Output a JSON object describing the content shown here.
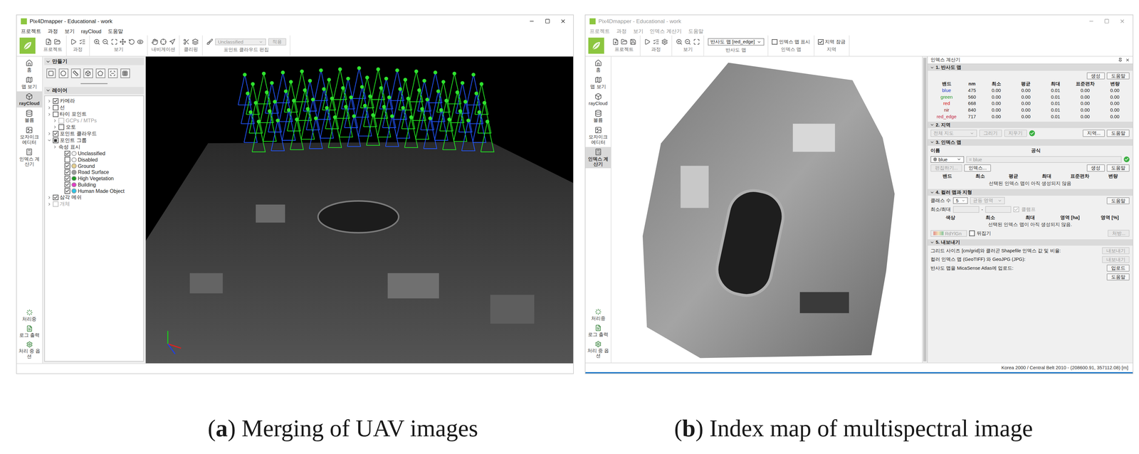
{
  "left_window": {
    "title": "Pix4Dmapper - Educational - work",
    "active": true,
    "menu": [
      "프로젝트",
      "과정",
      "보기",
      "rayCloud",
      "도움말"
    ],
    "toolbar_groups": [
      "프로젝트",
      "과정",
      "보기",
      "내비게이션",
      "클리핑",
      "포인트 클라우드 편집"
    ],
    "class_select": {
      "value": "Unclassified",
      "disabled": true
    },
    "apply_button": {
      "label": "적용",
      "disabled": true
    },
    "nav": [
      {
        "label": "홈",
        "selected": false
      },
      {
        "label": "맵 보기",
        "selected": false
      },
      {
        "label": "rayCloud",
        "selected": true
      },
      {
        "label": "볼륨",
        "selected": false
      },
      {
        "label": "모자이크 에디터",
        "selected": false
      },
      {
        "label": "인덱스 계산기",
        "selected": false
      }
    ],
    "nav_bottom": [
      "처리중",
      "로그 출력",
      "처리 중 옵션"
    ],
    "create_panel": {
      "title": "만들기",
      "expanded": true
    },
    "layers": {
      "title": "레이어",
      "expanded": true,
      "items": [
        {
          "label": "카메라",
          "kind": "check",
          "depth": 0,
          "expandable": true,
          "expanded": false,
          "checked": true,
          "mixed": false,
          "disabled": false
        },
        {
          "label": "선",
          "kind": "check",
          "depth": 0,
          "expandable": true,
          "expanded": false,
          "checked": false,
          "mixed": false,
          "disabled": false
        },
        {
          "label": "타이 포인트",
          "kind": "check",
          "depth": 0,
          "expandable": true,
          "expanded": false,
          "checked": false,
          "mixed": false,
          "disabled": false
        },
        {
          "label": "GCPs / MTPs",
          "kind": "check",
          "depth": 1,
          "expandable": true,
          "expanded": false,
          "checked": false,
          "mixed": false,
          "disabled": true
        },
        {
          "label": "오토",
          "kind": "check",
          "depth": 1,
          "expandable": true,
          "expanded": false,
          "checked": false,
          "mixed": false,
          "disabled": false
        },
        {
          "label": "포인트 클라우드",
          "kind": "check",
          "depth": 0,
          "expandable": true,
          "expanded": false,
          "checked": true,
          "mixed": false,
          "disabled": false
        },
        {
          "label": "포인트 그룹",
          "kind": "check",
          "depth": 0,
          "expandable": true,
          "expanded": true,
          "checked": true,
          "mixed": true,
          "disabled": false
        },
        {
          "label": "속성 표시",
          "kind": "text",
          "depth": 1,
          "expandable": true,
          "expanded": false,
          "checked": false,
          "mixed": false,
          "disabled": false
        },
        {
          "label": "Unclassified",
          "kind": "class",
          "depth": 2,
          "expandable": false,
          "expanded": false,
          "checked": true,
          "mixed": false,
          "disabled": false,
          "color": "#f4f4f4"
        },
        {
          "label": "Disabled",
          "kind": "class",
          "depth": 2,
          "expandable": false,
          "expanded": false,
          "checked": false,
          "mixed": false,
          "disabled": false,
          "color": "#f4f4f4"
        },
        {
          "label": "Ground",
          "kind": "class",
          "depth": 2,
          "expandable": false,
          "expanded": false,
          "checked": true,
          "mixed": false,
          "disabled": false,
          "color": "#e6cf8e"
        },
        {
          "label": "Road Surface",
          "kind": "class",
          "depth": 2,
          "expandable": false,
          "expanded": false,
          "checked": true,
          "mixed": false,
          "disabled": false,
          "color": "#9a9a9a"
        },
        {
          "label": "High Vegetation",
          "kind": "class",
          "depth": 2,
          "expandable": false,
          "expanded": false,
          "checked": true,
          "mixed": false,
          "disabled": false,
          "color": "#1c9a22"
        },
        {
          "label": "Building",
          "kind": "class",
          "depth": 2,
          "expandable": false,
          "expanded": false,
          "checked": true,
          "mixed": false,
          "disabled": false,
          "color": "#e23cc4"
        },
        {
          "label": "Human Made Object",
          "kind": "class",
          "depth": 2,
          "expandable": false,
          "expanded": false,
          "checked": true,
          "mixed": false,
          "disabled": false,
          "color": "#2fc4e4"
        },
        {
          "label": "삼각 메쉬",
          "kind": "check",
          "depth": 0,
          "expandable": true,
          "expanded": false,
          "checked": true,
          "mixed": false,
          "disabled": false
        },
        {
          "label": "개체",
          "kind": "check",
          "depth": 0,
          "expandable": true,
          "expanded": false,
          "checked": false,
          "mixed": false,
          "disabled": true
        }
      ]
    }
  },
  "right_window": {
    "title": "Pix4Dmapper - Educational - work",
    "active": false,
    "menu": [
      "프로젝트",
      "과정",
      "보기",
      "인덱스 계산기",
      "도움말"
    ],
    "toolbar_groups": [
      "프로젝트",
      "과정",
      "보기",
      "반사도 맵",
      "인덱스 맵",
      "지역"
    ],
    "map_select": {
      "value": "반사도 맵 [red_edge]"
    },
    "toolbar_checks": [
      {
        "label": "인덱스 맵 표시",
        "checked": false
      },
      {
        "label": "지역 잠금",
        "checked": true
      }
    ],
    "nav": [
      {
        "label": "홈",
        "selected": false
      },
      {
        "label": "맵 보기",
        "selected": false
      },
      {
        "label": "rayCloud",
        "selected": false
      },
      {
        "label": "볼륨",
        "selected": false
      },
      {
        "label": "모자이크 에디터",
        "selected": false
      },
      {
        "label": "인덱스 계산기",
        "selected": true
      }
    ],
    "nav_bottom": [
      "처리중",
      "로그 출력",
      "처리 중 옵션"
    ],
    "panel": {
      "title": "인덱스 계산기",
      "reflectance": {
        "title": "1. 반사도 맵",
        "expanded": true,
        "buttons": [
          {
            "label": "생성",
            "disabled": false
          },
          {
            "label": "도움말",
            "disabled": false
          }
        ],
        "columns": [
          "밴드",
          "nm",
          "최소",
          "평균",
          "최대",
          "표준편차",
          "변량"
        ],
        "rows": [
          {
            "band": "blue",
            "nm": "475",
            "min": "0.00",
            "mean": "0.00",
            "max": "0.01",
            "std": "0.00",
            "var": "0.00",
            "color": "#2442c8"
          },
          {
            "band": "green",
            "nm": "560",
            "min": "0.00",
            "mean": "0.00",
            "max": "0.01",
            "std": "0.00",
            "var": "0.00",
            "color": "#2a9a2a"
          },
          {
            "band": "red",
            "nm": "668",
            "min": "0.00",
            "mean": "0.00",
            "max": "0.01",
            "std": "0.00",
            "var": "0.00",
            "color": "#d42020"
          },
          {
            "band": "nir",
            "nm": "840",
            "min": "0.00",
            "mean": "0.00",
            "max": "0.01",
            "std": "0.00",
            "var": "0.00",
            "color": "#8b1a1a"
          },
          {
            "band": "red_edge",
            "nm": "717",
            "min": "0.00",
            "mean": "0.00",
            "max": "0.01",
            "std": "0.00",
            "var": "0.00",
            "color": "#c4304a"
          }
        ]
      },
      "region": {
        "title": "2. 지역",
        "expanded": true,
        "select": {
          "value": "전체 지도",
          "disabled": true
        },
        "buttons": [
          {
            "label": "그리기",
            "disabled": true
          },
          {
            "label": "지우기",
            "disabled": true
          }
        ],
        "valid": true,
        "right_buttons": [
          {
            "label": "지역...",
            "disabled": false
          },
          {
            "label": "도움말",
            "disabled": false
          }
        ]
      },
      "index_map": {
        "title": "3. 인덱스 맵",
        "expanded": true,
        "name_label": "이름",
        "formula_label": "공식",
        "index_select": {
          "value": "blue"
        },
        "formula": {
          "value": "= blue",
          "disabled": true
        },
        "valid": true,
        "left_buttons": [
          {
            "label": "편집하기...",
            "disabled": true
          },
          {
            "label": "인덱스...",
            "disabled": false
          }
        ],
        "right_buttons": [
          {
            "label": "생성",
            "disabled": false
          },
          {
            "label": "도움말",
            "disabled": false
          }
        ],
        "columns": [
          "밴드",
          "최소",
          "평균",
          "최대",
          "표준편차",
          "변량"
        ],
        "message": "선택된 인덱스 맵이 아직 생성되지 않음"
      },
      "color_map": {
        "title": "4. 컬러 맵과 지형",
        "expanded": true,
        "class_count": {
          "label": "클래스 수",
          "value": "5"
        },
        "mode_select": {
          "value": "균등 영역",
          "disabled": true
        },
        "help": {
          "label": "도움말",
          "disabled": false
        },
        "min_max": {
          "label": "최소/최대",
          "separator": "-",
          "disabled": true
        },
        "clamp": {
          "label": "클램프",
          "checked": true,
          "disabled": true
        },
        "columns": [
          "색상",
          "최소",
          "최대",
          "영역 [ha]",
          "영역 [%]"
        ],
        "message": "선택된 인덱스 맵이 아직 생성되지 않음.",
        "palette_select": {
          "value": "RdYlGn",
          "disabled": true
        },
        "flip": {
          "label": "뒤집기",
          "checked": false
        },
        "prescription": {
          "label": "처방...",
          "disabled": true
        }
      },
      "export": {
        "title": "5. 내보내기",
        "expanded": true,
        "rows": [
          {
            "label": "그리드 사이즈 [cm/grid]와 클러곤 Shapefile 인덱스 값 및 비율:",
            "button": "내보내기",
            "disabled": true
          },
          {
            "label": "컬러 인덱스 맵 (GeoTIFF) 와 GeoJPG (JPG):",
            "button": "내보내기",
            "disabled": true
          },
          {
            "label": "반사도 맵을 MicaSense Atlas에 업로드:",
            "button": "업로드",
            "disabled": false
          }
        ],
        "help": {
          "label": "도움말",
          "disabled": false
        }
      }
    },
    "status_bar": "Korea 2000 / Central Belt 2010 - (208600.91, 357112.08) [m]"
  },
  "captions": [
    {
      "open": "(",
      "label": "a",
      "rest": ") Merging of UAV images"
    },
    {
      "open": "(",
      "label": "b",
      "rest": ") Index map of multispectral image"
    }
  ]
}
